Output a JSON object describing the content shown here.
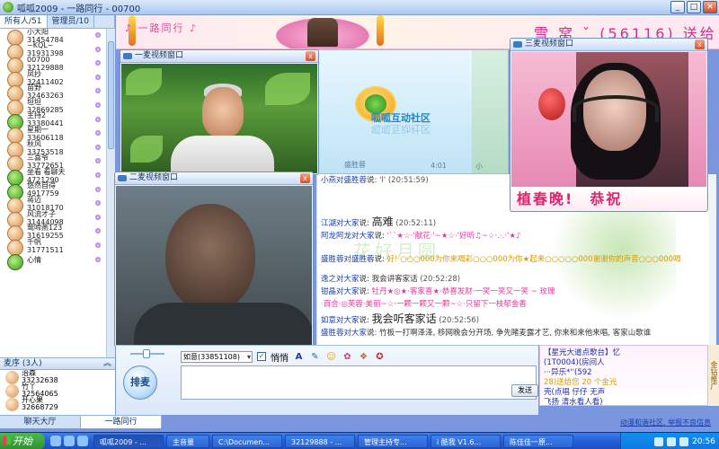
{
  "window": {
    "title": "呱呱2009 - 一路同行 - 00700",
    "minimize": "_",
    "maximize": "□",
    "close": "✕"
  },
  "left_panel": {
    "tabs": [
      "所有人/51",
      "管理员/10"
    ],
    "users": [
      {
        "name": "小大阳",
        "id": "31454784",
        "avatar": "face"
      },
      {
        "name": "~KQL~",
        "id": "31931398",
        "avatar": "face"
      },
      {
        "name": "00700",
        "id": "32129888",
        "avatar": "face"
      },
      {
        "name": "凤抄",
        "id": "32411402",
        "avatar": "face"
      },
      {
        "name": "苗野",
        "id": "32463263",
        "avatar": "face"
      },
      {
        "name": "坦坦",
        "id": "32869285",
        "avatar": "face"
      },
      {
        "name": "主持2",
        "id": "33380441",
        "avatar": "frog"
      },
      {
        "name": "星期一",
        "id": "33606118",
        "avatar": "face"
      },
      {
        "name": "秋风",
        "id": "33753518",
        "avatar": "face"
      },
      {
        "name": "三喜爷",
        "id": "33772651",
        "avatar": "face"
      },
      {
        "name": "坐看 看聊天",
        "id": "4721290",
        "avatar": "frog"
      },
      {
        "name": "悠然自得",
        "id": "4917759",
        "avatar": "frog"
      },
      {
        "name": "蒋迈",
        "id": "31018170",
        "avatar": "face"
      },
      {
        "name": "风流才子",
        "id": "31444098",
        "avatar": "face"
      },
      {
        "name": "莺啼燕123",
        "id": "31619255",
        "avatar": "face"
      },
      {
        "name": "千帆",
        "id": "31771511",
        "avatar": "face"
      },
      {
        "name": "心情",
        "id": "",
        "avatar": "frog"
      }
    ],
    "queue": {
      "label": "麦序",
      "count": "(3人)",
      "chevron": "︽"
    },
    "queue_users": [
      {
        "name": "治森",
        "id": "33232638"
      },
      {
        "name": "竹丫",
        "id": "32564065"
      },
      {
        "name": "开心果",
        "id": "32668729"
      }
    ],
    "bottom_tabs": [
      "聊天大厅",
      "一路同行"
    ]
  },
  "banner": {
    "left_text": "♪ 一路同行 ♪",
    "right_text": "雪 窝 ˇ (56116) 送给"
  },
  "video1": {
    "title": "一麦视频窗口",
    "close": "x"
  },
  "video2": {
    "title": "二麦视频窗口",
    "close": "x"
  },
  "video3": {
    "title": "三麦视频窗口",
    "close": "x",
    "caption_left": "植春晚!",
    "caption_right": "恭祝"
  },
  "mid_video": {
    "brand": "呱呱互动社区",
    "user": "盛胜蓉",
    "time": "4:01",
    "side": "小"
  },
  "chat": {
    "watermark": "花好月圆",
    "lines": [
      {
        "user": "小燕对盛胜蓉",
        "verb": "说:",
        "msg": "'l'",
        "time": "(20:51:59)",
        "style": "small"
      },
      {
        "user": "江湖对大家",
        "verb": "说:",
        "msg": "高难",
        "time": "(20:52:11)",
        "style": "big"
      },
      {
        "user": "阿龙阿龙对大家",
        "verb": "说:",
        "msg": "'``★☆·'献花·'~★☆·'好听♫~☆·.·.·'★♪",
        "time": "",
        "style": "pink"
      },
      {
        "user": "盛胜蓉对盛胜蓉",
        "verb": "说:",
        "msg": "好! ○○○000为你来喝彩○○○000为你★起来○○○○○000谢谢你的声音○○○000喝",
        "time": "",
        "style": "gold"
      },
      {
        "user": "逸之对大家",
        "verb": "说:",
        "msg": "我会讲客家话",
        "time": "(20:52:28)",
        "style": "normal"
      },
      {
        "user": "钳晶对大家",
        "verb": "说:",
        "msg": "牡丹★◎★·客家喜★·恭喜发财·一笑一笑又一笑 ~ 玫瑰",
        "time": "",
        "style": "pink"
      },
      {
        "user": "",
        "verb": "",
        "msg": "·百合·◎芙蓉·美丽~☆·一颗一颗又一颗~☆·只留下一枝郁金香",
        "time": "",
        "style": "pink"
      },
      {
        "user": "如意对大家",
        "verb": "说:",
        "msg": "我会听客家话",
        "time": "(20:52:56)",
        "style": "big"
      },
      {
        "user": "盛胜蓉对大家",
        "verb": "说:",
        "msg": "竹板一打啊泽泽, 移网晚会分开场, 争先睹麦露才艺, 你来和来他来唱, 客家山歌谁",
        "time": "",
        "style": "normal"
      }
    ]
  },
  "input": {
    "mic_label": "排麦",
    "font_value": "如意(33851108)",
    "private_label": "悄悄",
    "send_label": "发送",
    "message": ""
  },
  "right_ad": {
    "lines": [
      "【星光大道点歌台】忆",
      "(1T0004)(房间人",
      "···异乐*''(592",
      "28)送给您 20 个金光",
      "壳(点唱 仔仔 无声",
      "飞扬 清水看人看)"
    ],
    "side": "金钻推广",
    "link": "动漫和谐社区, 举报不良信息"
  },
  "taskbar": {
    "start": "开始",
    "tasks": [
      {
        "label": "呱呱2009 - ...",
        "active": true
      },
      {
        "label": "主音量",
        "active": false
      },
      {
        "label": "C:\\Documen...",
        "active": false
      },
      {
        "label": "32129888 - ...",
        "active": false
      },
      {
        "label": "管理主持专...",
        "active": false
      },
      {
        "label": "i 酷我 V1.6...",
        "active": false
      },
      {
        "label": "陈佳佳一原...",
        "active": false
      }
    ],
    "clock": "20:56"
  }
}
